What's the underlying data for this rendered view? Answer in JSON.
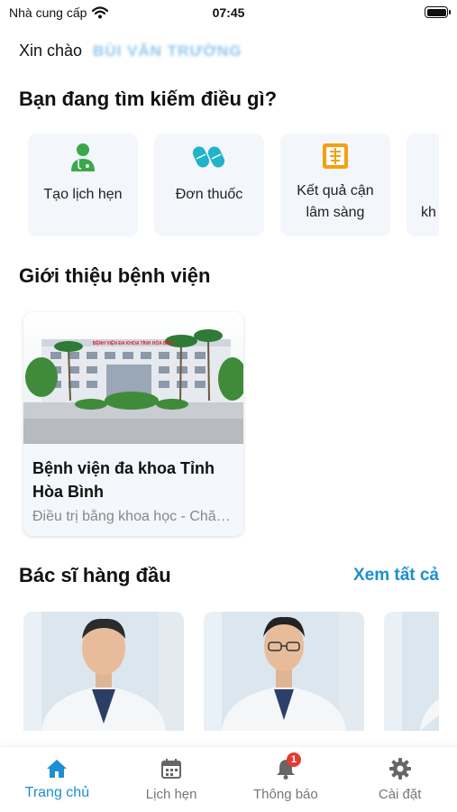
{
  "status_bar": {
    "carrier": "Nhà cung cấp",
    "time": "07:45"
  },
  "greeting": {
    "prefix": "Xin chào",
    "user_name": "BÙI VĂN TRƯỜNG"
  },
  "search_section": {
    "title": "Bạn đang tìm kiếm điều gì?"
  },
  "quick_actions": [
    {
      "label": "Tạo lịch hẹn",
      "icon": "doctor-icon"
    },
    {
      "label": "Đơn thuốc",
      "icon": "pill-icon"
    },
    {
      "label": "Kết quả cận lâm sàng",
      "icon": "lab-result-icon"
    },
    {
      "label": "kh",
      "icon": ""
    }
  ],
  "hospital_section": {
    "title": "Giới thiệu bệnh viện",
    "card": {
      "name": "Bệnh viện đa khoa Tỉnh Hòa Bình",
      "subtitle": "Điều trị bằng khoa học - Chăm sóc bằng tận tâm",
      "sign_text": "BỆNH VIỆN ĐA KHOA TỈNH HÒA BÌNH"
    }
  },
  "doctors_section": {
    "title": "Bác sĩ hàng đầu",
    "see_all": "Xem tất cả"
  },
  "bottom_nav": {
    "items": [
      {
        "label": "Trang chủ",
        "icon": "home-icon",
        "active": true
      },
      {
        "label": "Lịch hẹn",
        "icon": "calendar-icon"
      },
      {
        "label": "Thông báo",
        "icon": "bell-icon",
        "badge": "1"
      },
      {
        "label": "Cài đặt",
        "icon": "gear-icon"
      }
    ]
  },
  "colors": {
    "accent": "#1b8fd1",
    "card_bg": "#f3f6fb",
    "badge": "#e53935",
    "green": "#3aa84a",
    "teal": "#21b3c9",
    "orange": "#f4a012"
  }
}
